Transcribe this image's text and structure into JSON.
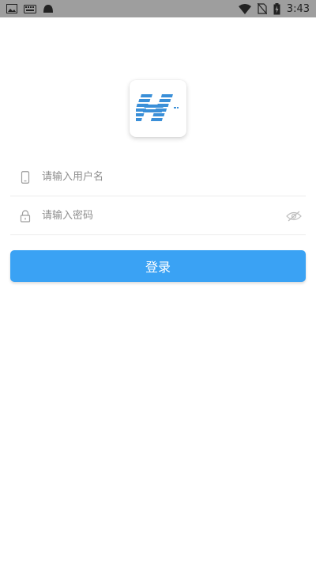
{
  "status_bar": {
    "time": "3:43",
    "left_icons": [
      "image-icon",
      "keyboard-icon",
      "android-icon"
    ],
    "right_icons": [
      "wifi-icon",
      "no-sim-icon",
      "battery-charging-icon"
    ]
  },
  "logo": {
    "letter": "H",
    "color": "#3a8fd8"
  },
  "form": {
    "username_placeholder": "请输入用户名",
    "password_placeholder": "请输入密码",
    "login_label": "登录"
  },
  "colors": {
    "accent": "#3aa2f4",
    "divider": "#ececec",
    "icon_gray": "#9e9e9e"
  }
}
